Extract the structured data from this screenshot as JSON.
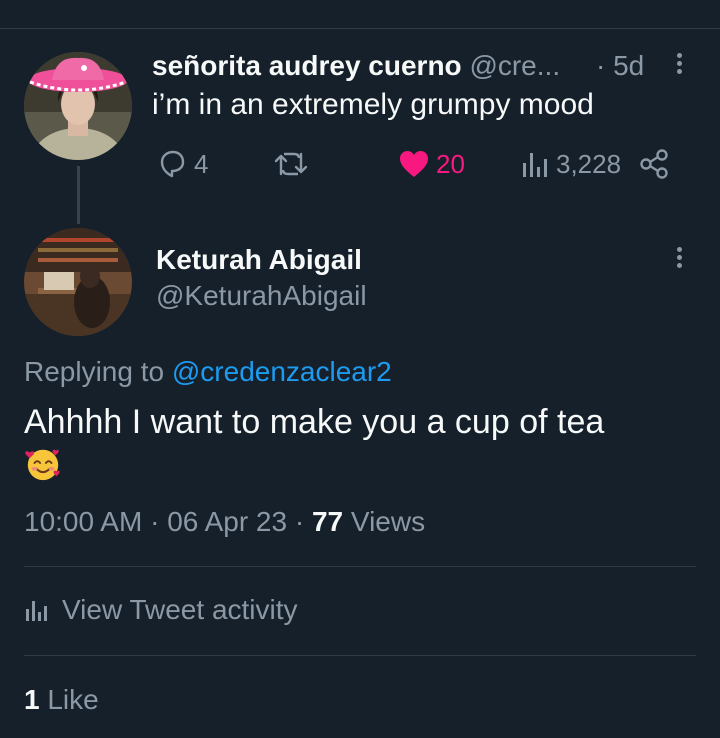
{
  "parent_tweet": {
    "display_name": "señorita audrey cuerno",
    "handle": "@cre...",
    "time": "· 5d",
    "text": "i’m in an extremely grumpy mood",
    "reply_count": "4",
    "like_count": "20",
    "view_count": "3,228",
    "like_color": "#f91880"
  },
  "main_tweet": {
    "display_name": "Keturah Abigail",
    "handle": "@KeturahAbigail",
    "replying_prefix": "Replying to",
    "replying_handle": "@credenzaclear2",
    "text": "Ahhhh I want to make you a cup of tea",
    "emoji": "smiling-face-with-hearts",
    "time": "10:00 AM",
    "date": "06 Apr 23",
    "views_count": "77",
    "views_label": "Views",
    "activity_label": "View Tweet activity",
    "like_count": "1",
    "like_label": "Like",
    "mention_color": "#1d9bf0"
  },
  "theme": {
    "background": "#15202b",
    "text": "#f7f9f9",
    "secondary": "#8b98a5"
  }
}
